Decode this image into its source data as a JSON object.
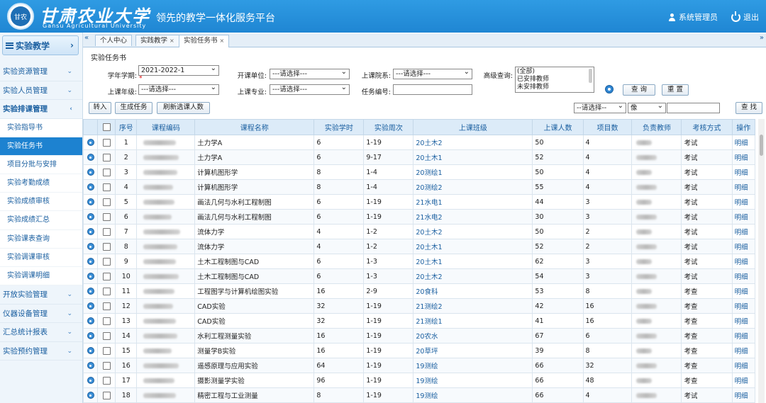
{
  "header": {
    "logo_seal_text": "甘农",
    "logo_cn": "甘肃农业大学",
    "logo_en": "Gansu Agricultural University",
    "slogan": "领先的教学一体化服务平台",
    "user_label": "系统管理员",
    "logout_label": "退出",
    "color": "#1f86d3"
  },
  "sidebar": {
    "top_label": "实验教学",
    "top_arrow": "›",
    "items": [
      {
        "label": "实验资源管理",
        "chev": "⌄"
      },
      {
        "label": "实验人员管理",
        "chev": "⌄"
      },
      {
        "label": "实验排课管理",
        "chev": "‹"
      }
    ],
    "sub_items": [
      "实验指导书",
      "实验任务书",
      "项目分批与安排",
      "实验考勤成绩",
      "实验成绩审核",
      "实验成绩汇总",
      "实验课表查询",
      "实验调课审核",
      "实验调课明细"
    ],
    "items_after": [
      {
        "label": "开放实验管理",
        "chev": "⌄"
      },
      {
        "label": "仪器设备管理",
        "chev": "⌄"
      },
      {
        "label": "汇总统计报表",
        "chev": "⌄"
      },
      {
        "label": "实验预约管理",
        "chev": "⌄"
      }
    ]
  },
  "tabs": {
    "left_nav": "«",
    "right_nav": "»",
    "items": [
      {
        "label": "个人中心",
        "close": ""
      },
      {
        "label": "实践教学",
        "close": "×"
      },
      {
        "label": "实验任务书",
        "close": "×"
      }
    ]
  },
  "form": {
    "page_title": "实验任务书",
    "term_label": "学年学期:",
    "term_value": "2021-2022-1",
    "required_mark": "*",
    "unit_label": "开课单位:",
    "dept_label": "上课院系:",
    "advanced_label": "高级查询:",
    "grade_label": "上课年级:",
    "major_label": "上课专业:",
    "taskno_label": "任务编号:",
    "placeholder_select": "---请选择---",
    "advanced_options": [
      "(全部)",
      "已安排教师",
      "未安排教师"
    ],
    "query_btn": "查 询",
    "reset_btn": "重 置"
  },
  "toolbar": {
    "import_btn": "转入",
    "generate_btn": "生成任务",
    "refresh_btn": "刷新选课人数",
    "filter_select": "--请选择--",
    "match_select": "像",
    "find_btn": "查 找"
  },
  "table": {
    "headers": [
      "",
      "",
      "序号",
      "课程编码",
      "课程名称",
      "实验学时",
      "实验周次",
      "上课班级",
      "上课人数",
      "项目数",
      "负责教师",
      "考核方式",
      "操作"
    ],
    "detail_label": "明细",
    "rows": [
      {
        "no": "1",
        "name": "土力学A",
        "hours": "6",
        "weeks": "1-19",
        "cls": "20土木2",
        "count": "50",
        "items": "4",
        "exam": "考试"
      },
      {
        "no": "2",
        "name": "土力学A",
        "hours": "6",
        "weeks": "9-17",
        "cls": "20土木1",
        "count": "52",
        "items": "4",
        "exam": "考试"
      },
      {
        "no": "3",
        "name": "计算机图形学",
        "hours": "8",
        "weeks": "1-4",
        "cls": "20测绘1",
        "count": "50",
        "items": "4",
        "exam": "考试"
      },
      {
        "no": "4",
        "name": "计算机图形学",
        "hours": "8",
        "weeks": "1-4",
        "cls": "20测绘2",
        "count": "55",
        "items": "4",
        "exam": "考试"
      },
      {
        "no": "5",
        "name": "画法几何与水利工程制图",
        "hours": "6",
        "weeks": "1-19",
        "cls": "21水电1",
        "count": "44",
        "items": "3",
        "exam": "考试"
      },
      {
        "no": "6",
        "name": "画法几何与水利工程制图",
        "hours": "6",
        "weeks": "1-19",
        "cls": "21水电2",
        "count": "30",
        "items": "3",
        "exam": "考试"
      },
      {
        "no": "7",
        "name": "流体力学",
        "hours": "4",
        "weeks": "1-2",
        "cls": "20土木2",
        "count": "50",
        "items": "2",
        "exam": "考试"
      },
      {
        "no": "8",
        "name": "流体力学",
        "hours": "4",
        "weeks": "1-2",
        "cls": "20土木1",
        "count": "52",
        "items": "2",
        "exam": "考试"
      },
      {
        "no": "9",
        "name": "土木工程制图与CAD",
        "hours": "6",
        "weeks": "1-3",
        "cls": "20土木1",
        "count": "62",
        "items": "3",
        "exam": "考试"
      },
      {
        "no": "10",
        "name": "土木工程制图与CAD",
        "hours": "6",
        "weeks": "1-3",
        "cls": "20土木2",
        "count": "54",
        "items": "3",
        "exam": "考试"
      },
      {
        "no": "11",
        "name": "工程图学与计算机绘图实验",
        "hours": "16",
        "weeks": "2-9",
        "cls": "20食科",
        "count": "53",
        "items": "8",
        "exam": "考查"
      },
      {
        "no": "12",
        "name": "CAD实验",
        "hours": "32",
        "weeks": "1-19",
        "cls": "21测绘2",
        "count": "42",
        "items": "16",
        "exam": "考查"
      },
      {
        "no": "13",
        "name": "CAD实验",
        "hours": "32",
        "weeks": "1-19",
        "cls": "21测绘1",
        "count": "41",
        "items": "16",
        "exam": "考查"
      },
      {
        "no": "14",
        "name": "水利工程测量实验",
        "hours": "16",
        "weeks": "1-19",
        "cls": "20农水",
        "count": "67",
        "items": "6",
        "exam": "考查"
      },
      {
        "no": "15",
        "name": "测量学B实验",
        "hours": "16",
        "weeks": "1-19",
        "cls": "20草坪",
        "count": "39",
        "items": "8",
        "exam": "考查"
      },
      {
        "no": "16",
        "name": "遥感原理与应用实验",
        "hours": "64",
        "weeks": "1-19",
        "cls": "19测绘",
        "count": "66",
        "items": "32",
        "exam": "考查"
      },
      {
        "no": "17",
        "name": "摄影测量学实验",
        "hours": "96",
        "weeks": "1-19",
        "cls": "19测绘",
        "count": "66",
        "items": "48",
        "exam": "考查"
      },
      {
        "no": "18",
        "name": "精密工程与工业测量",
        "hours": "8",
        "weeks": "1-19",
        "cls": "19测绘",
        "count": "66",
        "items": "4",
        "exam": "考试"
      }
    ]
  }
}
